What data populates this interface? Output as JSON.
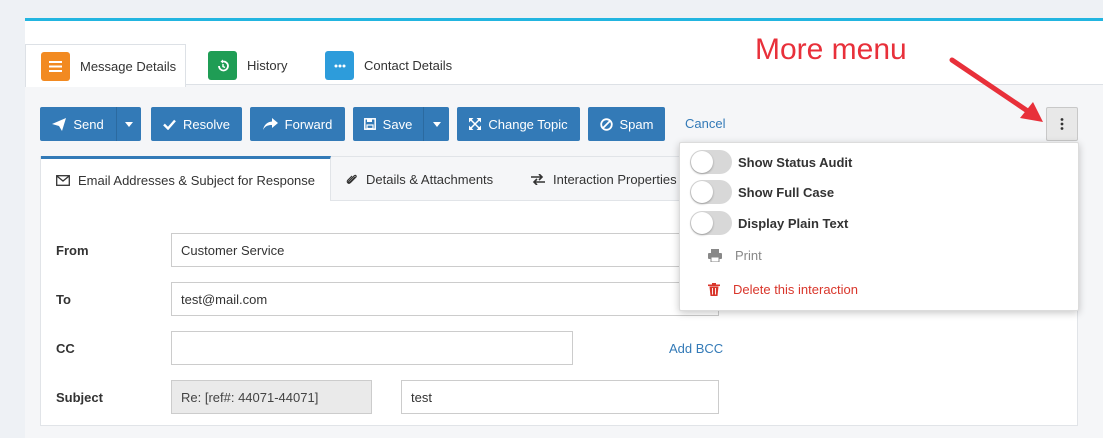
{
  "tabs": [
    {
      "label": "Message Details",
      "icon": "list-icon",
      "color": "#f28a21"
    },
    {
      "label": "History",
      "icon": "history-icon",
      "color": "#1f9d55"
    },
    {
      "label": "Contact Details",
      "icon": "ellipsis-icon",
      "color": "#2d9cdb"
    }
  ],
  "toolbar": {
    "send": "Send",
    "resolve": "Resolve",
    "forward": "Forward",
    "save": "Save",
    "change_topic": "Change Topic",
    "spam": "Spam",
    "cancel": "Cancel"
  },
  "subtabs": [
    {
      "label": "Email Addresses & Subject for Response",
      "icon": "envelope-icon"
    },
    {
      "label": "Details & Attachments",
      "icon": "paperclip-icon"
    },
    {
      "label": "Interaction Properties",
      "icon": "exchange-icon"
    }
  ],
  "form": {
    "from_label": "From",
    "from_value": "Customer Service",
    "to_label": "To",
    "to_value": "test@mail.com",
    "cc_label": "CC",
    "cc_value": "",
    "add_bcc": "Add BCC",
    "subject_label": "Subject",
    "subject_prefix": "Re: [ref#: 44071-44071]",
    "subject_value": "test"
  },
  "more_menu": {
    "show_status_audit": "Show Status Audit",
    "show_full_case": "Show Full Case",
    "display_plain_text": "Display Plain Text",
    "print": "Print",
    "delete": "Delete this interaction"
  },
  "annotation": "More menu",
  "colors": {
    "accent": "#337ab7",
    "top_border": "#22b5e0",
    "danger": "#d9362b",
    "annotation": "#e8303a"
  }
}
